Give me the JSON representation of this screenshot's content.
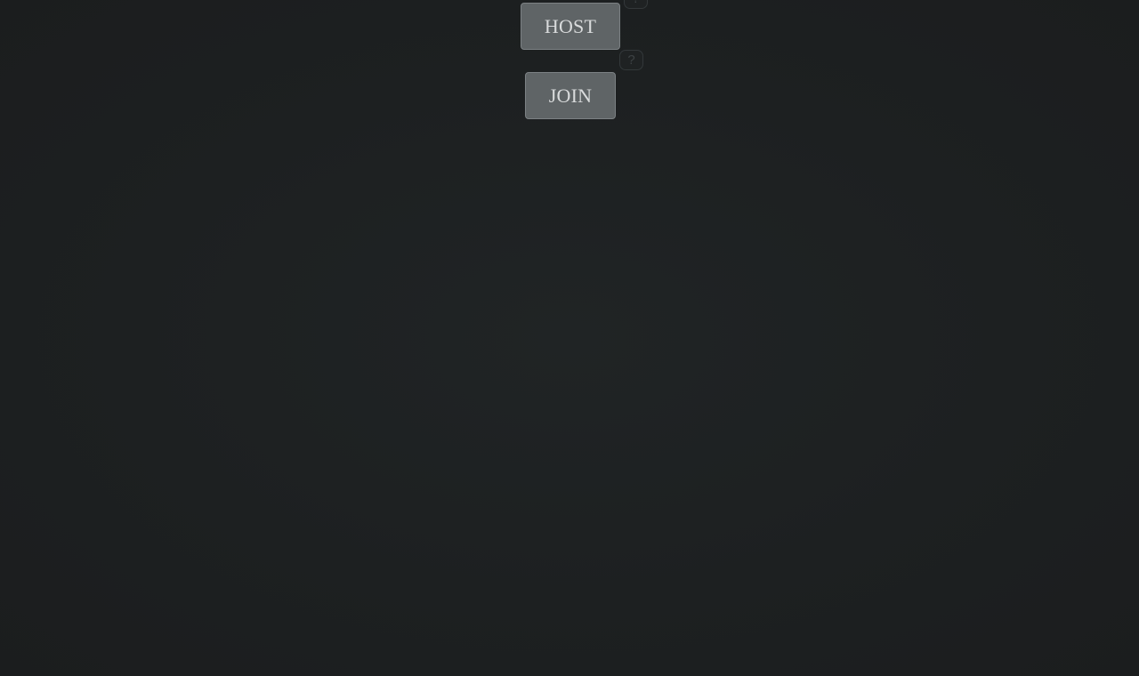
{
  "buttons": {
    "host_label": "HOST",
    "join_label": "JOIN"
  },
  "help": {
    "host_help_label": "?",
    "join_help_label": "?"
  },
  "icons": {
    "help": "question-mark-icon"
  },
  "colors": {
    "background": "#1e2122",
    "button_bg": "#5f6466",
    "button_border": "#7c8184",
    "button_text": "#d9dbdc",
    "help_border": "#33383a",
    "help_text": "#3d4244"
  }
}
